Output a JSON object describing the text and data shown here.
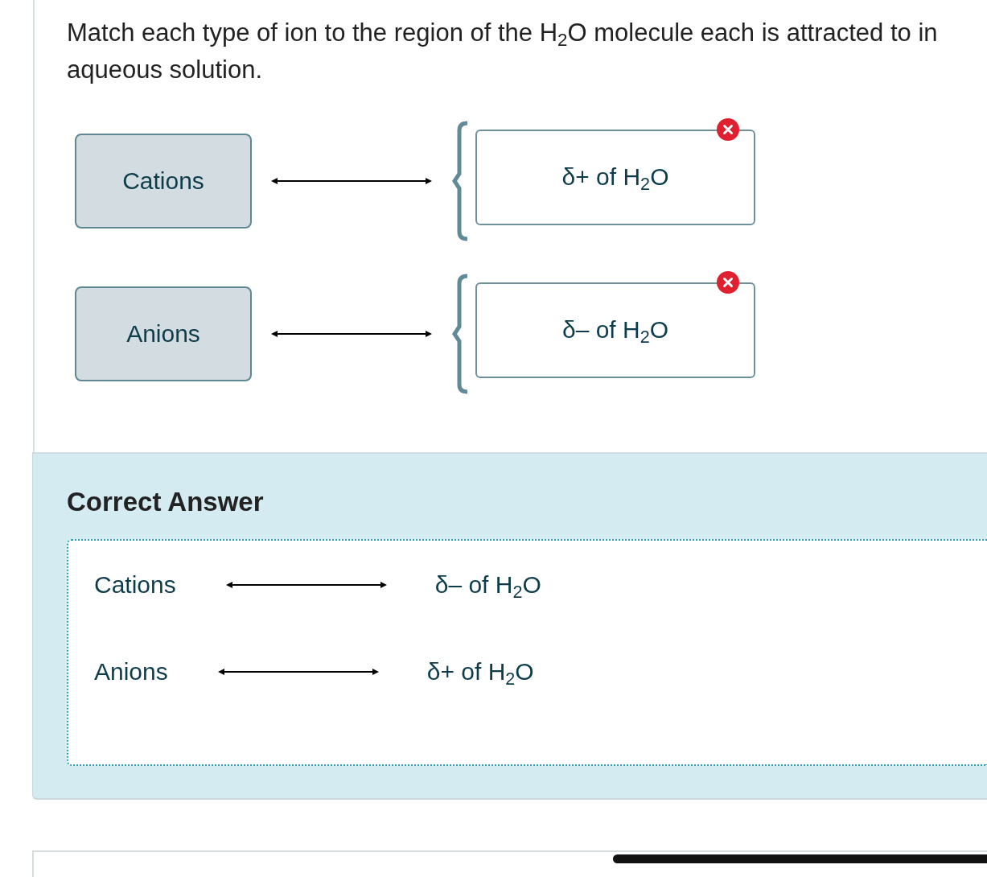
{
  "question": {
    "text": "Match each type of ion to the region of the H$_{2}$O molecule each is attracted to in aqueous solution."
  },
  "matches": [
    {
      "source": "Cations",
      "target": "δ+ of H$_{2}$O",
      "correct": false
    },
    {
      "source": "Anions",
      "target": "δ– of H$_{2}$O",
      "correct": false
    }
  ],
  "correct_answer": {
    "title": "Correct Answer",
    "pairs": [
      {
        "source": "Cations",
        "target": "δ– of H$_{2}$O"
      },
      {
        "source": "Anions",
        "target": "δ+ of H$_{2}$O"
      }
    ]
  }
}
